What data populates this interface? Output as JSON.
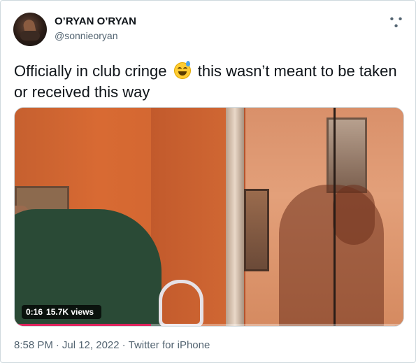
{
  "author": {
    "name": "O’RYAN O’RYAN",
    "handle": "@sonnieoryan"
  },
  "menu_icon": "more-horizontal-icon",
  "tweet": {
    "text_before": "Officially in club cringe",
    "emoji": "grinning-face-with-sweat-emoji",
    "text_after": "this wasn’t meant to be taken or received this way"
  },
  "video": {
    "time": "0:16",
    "views": "15.7K views",
    "progress": 0.35
  },
  "meta": {
    "time": "8:58 PM",
    "date": "Jul 12, 2022",
    "source": "Twitter for iPhone",
    "separator": "·"
  },
  "colors": {
    "text_primary": "#0f1419",
    "text_secondary": "#536471",
    "progress": "#e0245e"
  }
}
